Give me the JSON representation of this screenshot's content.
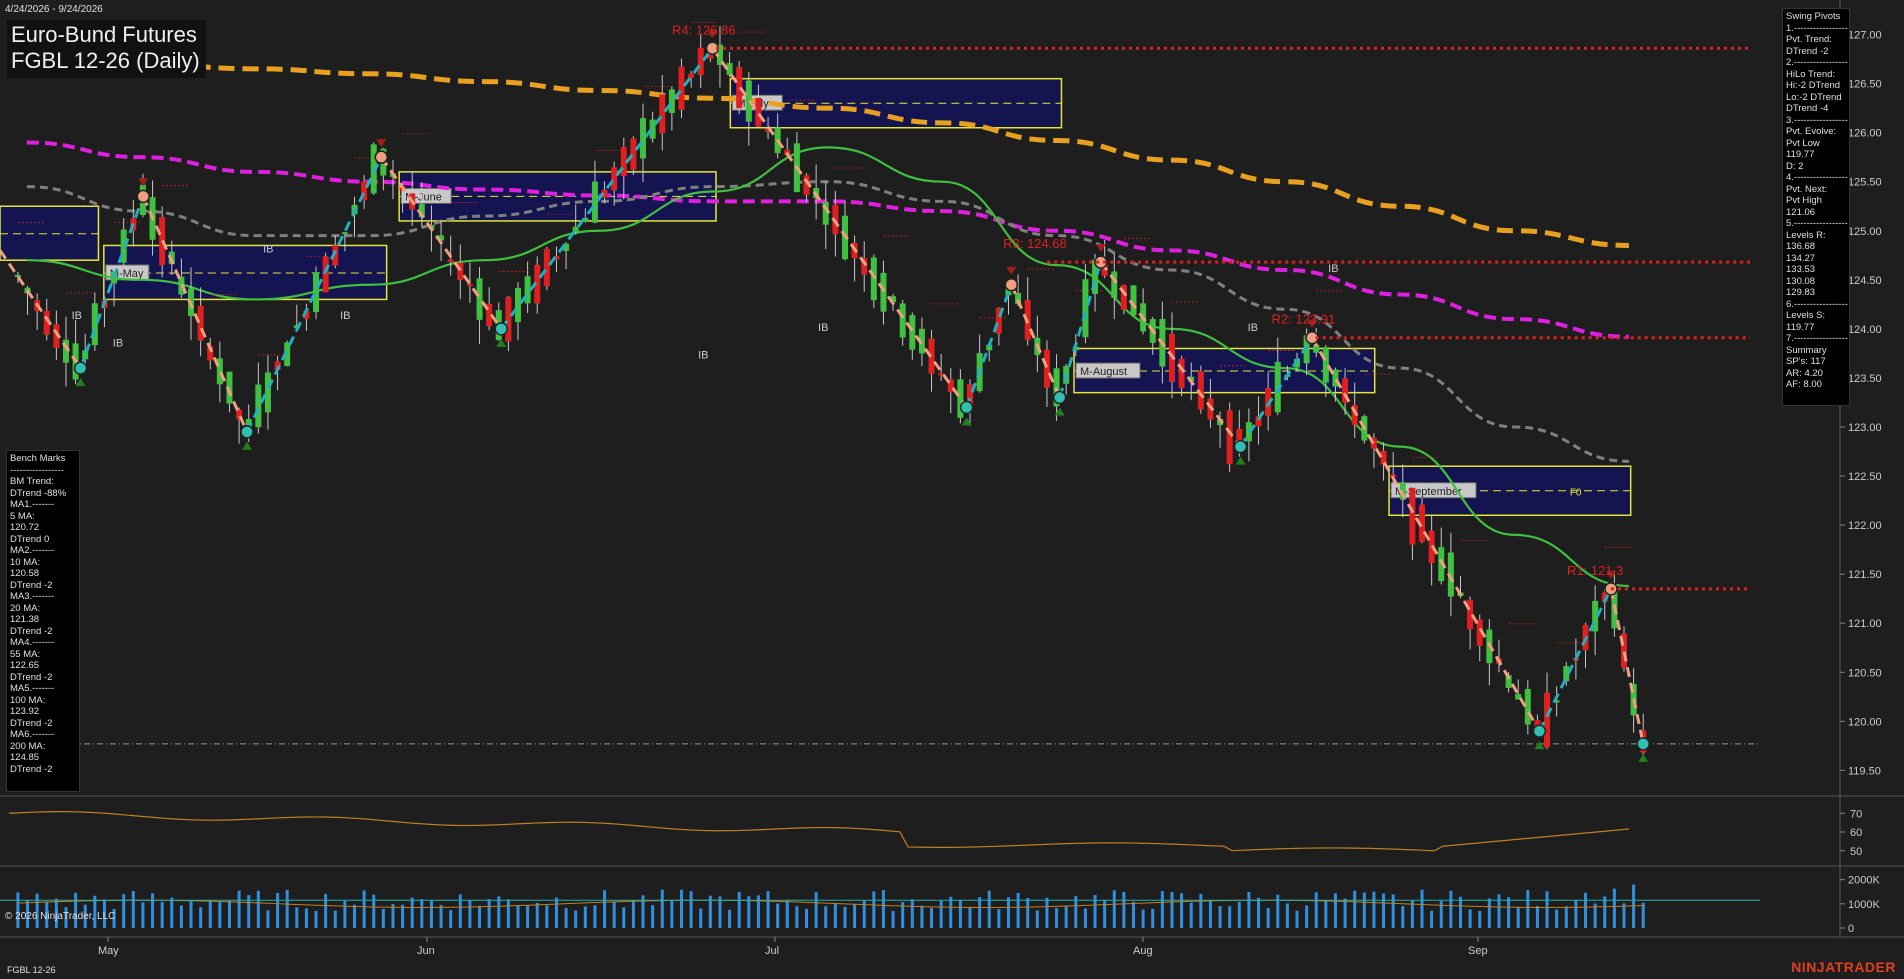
{
  "header": {
    "date_range": "4/24/2026 - 9/24/2026",
    "title": "Euro-Bund Futures",
    "subtitle": "FGBL 12-26 (Daily)"
  },
  "footer": {
    "copyright": "© 2026 NinjaTrader, LLC",
    "instrument": "FGBL 12-26",
    "brand": "NINJATRADER"
  },
  "swing_pivots": {
    "lines": [
      "Swing Pivots",
      "1.-----------------",
      "Pvt. Trend:",
      "DTrend -2",
      "2.-----------------",
      "HiLo Trend:",
      "Hi:-2 DTrend",
      "Lo:-2 DTrend",
      "DTrend -4",
      "3.-----------------",
      "Pvt. Evolve:",
      "Pvt Low",
      "119.77",
      "D: 2",
      "4.-----------------",
      "Pvt. Next:",
      "Pvt High",
      "121.06",
      "5.-----------------",
      "Levels R:",
      "136.68",
      "134.27",
      "133.53",
      "130.08",
      "129.83",
      "6.-----------------",
      "Levels S:",
      "119.77",
      "7.-----------------",
      "Summary",
      "SP's: 117",
      "AR: 4.20",
      "AF: 8.00"
    ]
  },
  "bench_marks": {
    "lines": [
      "Bench Marks",
      "-----------------",
      "BM Trend:",
      "DTrend -88%",
      "MA1.-------",
      "5 MA:",
      "120.72",
      "DTrend 0",
      "MA2.-------",
      "10 MA:",
      "120.58",
      "DTrend -2",
      "MA3.-------",
      "20 MA:",
      "121.38",
      "DTrend -2",
      "MA4.-------",
      "55 MA:",
      "122.65",
      "DTrend -2",
      "MA5.-------",
      "100 MA:",
      "123.92",
      "DTrend -2",
      "MA6.-------",
      "200 MA:",
      "124.85",
      "DTrend -2"
    ]
  },
  "chart_data": {
    "type": "candlestick",
    "x_tick_labels": [
      "May",
      "Jun",
      "Jul",
      "Aug",
      "Sep"
    ],
    "y_ticks": [
      "127.00",
      "126.50",
      "126.00",
      "125.50",
      "125.00",
      "124.50",
      "124.00",
      "123.50",
      "123.00",
      "122.50",
      "122.00",
      "121.50",
      "121.00",
      "120.50",
      "120.00",
      "119.50"
    ],
    "ylim": [
      119.3,
      127.25
    ],
    "osc_ticks": [
      "70",
      "60",
      "50"
    ],
    "osc_ylim": [
      44,
      76
    ],
    "vol_ticks": [
      "2000K",
      "1000K",
      "0"
    ],
    "vol_ylim": [
      0,
      2400
    ],
    "resistance_labels": [
      {
        "text": "R4: 126.86",
        "value": 126.86
      },
      {
        "text": "R3: 124.68",
        "value": 124.68
      },
      {
        "text": "R2: 123.91",
        "value": 123.91
      },
      {
        "text": "R1: 121.3",
        "value": 121.35
      }
    ],
    "support_level": 119.77,
    "monthly_boxes": [
      {
        "label": "",
        "hi": 125.25,
        "lo": 124.7,
        "mid": 124.97
      },
      {
        "label": "M-May",
        "hi": 124.85,
        "lo": 124.3,
        "mid": 124.57
      },
      {
        "label": "M-June",
        "hi": 125.6,
        "lo": 125.1,
        "mid": 125.35
      },
      {
        "label": "M-July",
        "hi": 126.55,
        "lo": 126.05,
        "mid": 126.3
      },
      {
        "label": "M-August",
        "hi": 123.8,
        "lo": 123.35,
        "mid": 123.57
      },
      {
        "label": "M-September",
        "hi": 122.6,
        "lo": 122.1,
        "mid": 122.35
      }
    ],
    "box_extra_label": "F0",
    "ib_label": "IB",
    "ma_lines": [
      {
        "name": "200",
        "color": "#e8a020",
        "values": [
          126.75,
          126.7,
          126.65,
          126.6,
          126.52,
          126.43,
          126.35,
          126.25,
          126.1,
          125.92,
          125.72,
          125.5,
          125.25,
          125.0,
          124.85
        ]
      },
      {
        "name": "100",
        "color": "#e020e0",
        "values": [
          125.9,
          125.75,
          125.6,
          125.5,
          125.42,
          125.36,
          125.3,
          125.3,
          125.2,
          125.0,
          124.8,
          124.6,
          124.35,
          124.1,
          123.92
        ]
      },
      {
        "name": "55",
        "color": "#808080",
        "values": [
          125.45,
          125.2,
          124.95,
          124.95,
          125.15,
          125.3,
          125.45,
          125.5,
          125.3,
          124.95,
          124.6,
          124.2,
          123.6,
          123.0,
          122.65
        ]
      },
      {
        "name": "20",
        "color": "#40c040",
        "values": [
          124.7,
          124.5,
          124.3,
          124.45,
          124.7,
          125.0,
          125.4,
          125.85,
          125.5,
          124.65,
          124.0,
          123.6,
          122.8,
          121.9,
          121.38
        ]
      }
    ],
    "swing_points": [
      {
        "value": 124.8,
        "type": "start"
      },
      {
        "value": 123.6,
        "type": "low"
      },
      {
        "value": 125.35,
        "type": "high"
      },
      {
        "value": 122.95,
        "type": "low"
      },
      {
        "value": 125.75,
        "type": "high"
      },
      {
        "value": 124.0,
        "type": "low"
      },
      {
        "value": 126.86,
        "type": "high"
      },
      {
        "value": 123.2,
        "type": "low"
      },
      {
        "value": 124.45,
        "type": "high"
      },
      {
        "value": 123.3,
        "type": "low"
      },
      {
        "value": 124.68,
        "type": "high"
      },
      {
        "value": 122.8,
        "type": "low"
      },
      {
        "value": 123.91,
        "type": "high"
      },
      {
        "value": 119.9,
        "type": "low"
      },
      {
        "value": 121.35,
        "type": "high"
      },
      {
        "value": 119.77,
        "type": "low"
      }
    ],
    "colors": {
      "up": "#40c040",
      "down": "#e02020",
      "swing_up": "#20b0c0",
      "swing_down": "#f0a080",
      "resistance": "#e02020",
      "volume": "#3090e0",
      "osc": "#c08020",
      "box_fill": "#141450",
      "box_border": "#e6e63a"
    }
  }
}
